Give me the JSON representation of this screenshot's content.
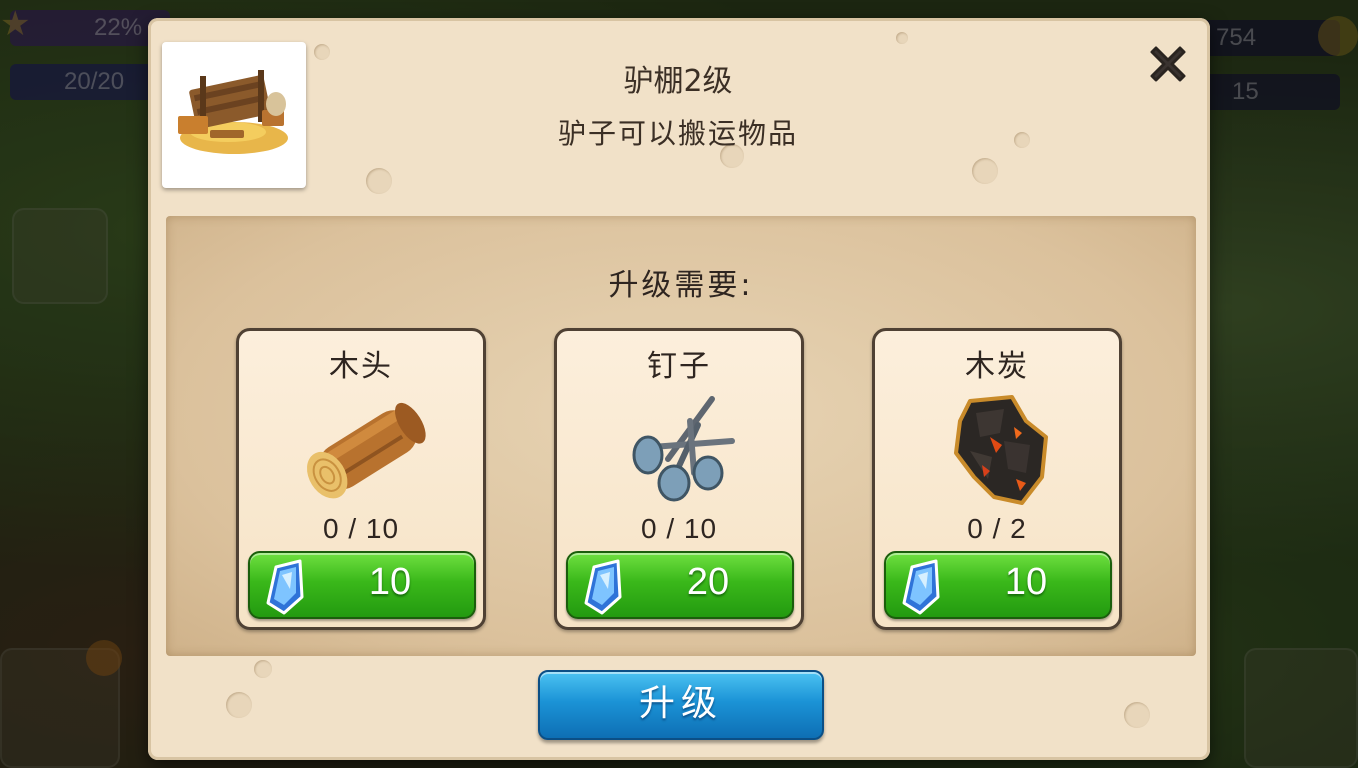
{
  "hud": {
    "progress_percent_text": "22%",
    "energy_text": "20/20",
    "coins_text": "754",
    "gems_text": "15"
  },
  "dialog": {
    "title": "驴棚2级",
    "subtitle": "驴子可以搬运物品",
    "thumbnail_icon": "donkey-shed-icon",
    "close_icon": "close-x-icon"
  },
  "requirements": {
    "heading": "升级需要:",
    "items": [
      {
        "name": "木头",
        "icon": "wood-log-icon",
        "count": "0 / 10",
        "price": "10",
        "currency_icon": "blue-gem-icon"
      },
      {
        "name": "钉子",
        "icon": "nails-icon",
        "count": "0 / 10",
        "price": "20",
        "currency_icon": "blue-gem-icon"
      },
      {
        "name": "木炭",
        "icon": "charcoal-icon",
        "count": "0 / 2",
        "price": "10",
        "currency_icon": "blue-gem-icon"
      }
    ]
  },
  "upgrade_button": {
    "label": "升级"
  },
  "colors": {
    "dialog_bg": "#f1e1c8",
    "buy_button": "#3ab81a",
    "upgrade_button": "#1b93d6",
    "text_dark": "#2e2520"
  }
}
